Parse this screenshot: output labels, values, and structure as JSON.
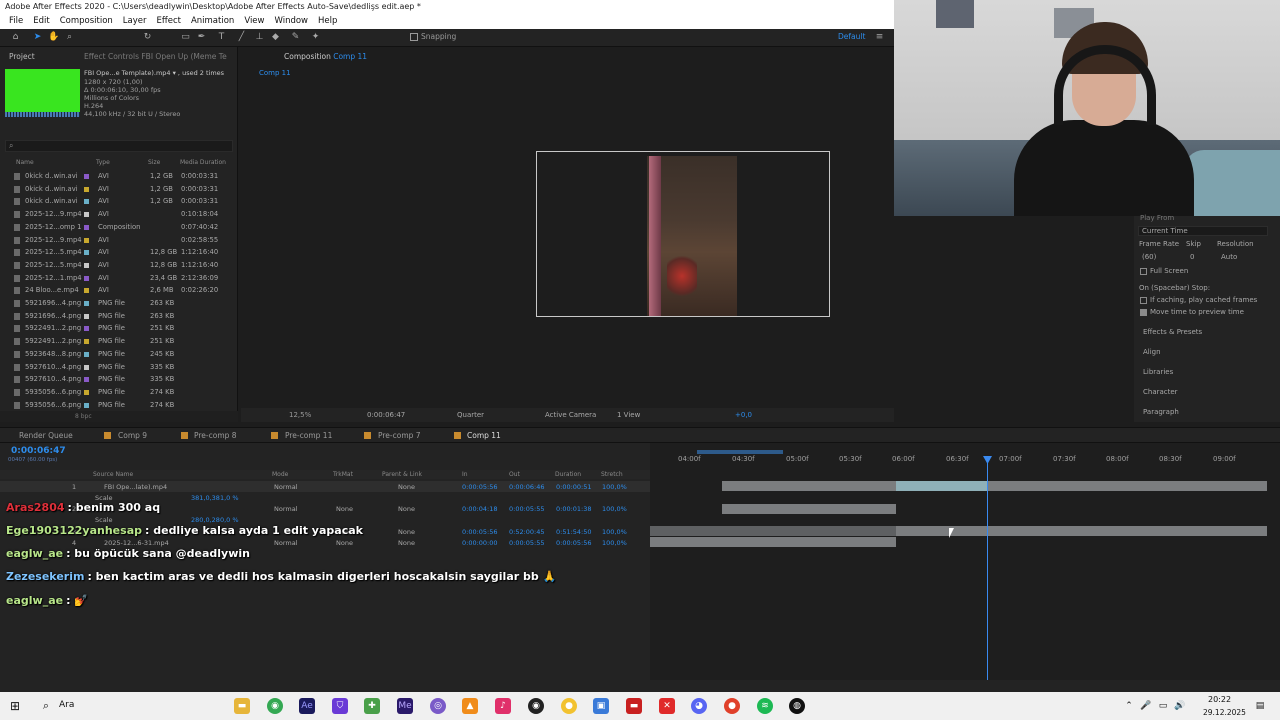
{
  "window": {
    "title": "Adobe After Effects 2020 - C:\\Users\\deadlywin\\Desktop\\Adobe After Effects Auto-Save\\dedlişs edit.aep *"
  },
  "menu": [
    "File",
    "Edit",
    "Composition",
    "Layer",
    "Effect",
    "Animation",
    "View",
    "Window",
    "Help"
  ],
  "toolbar": {
    "snapping": "Snapping",
    "workspace": "Default"
  },
  "project": {
    "tab": "Project",
    "effect_tab": "Effect Controls FBI Open Up (Meme Te",
    "file": {
      "name": "FBI Ope...e Template).mp4 ▾ , used 2 times",
      "size": "1280 x 720 (1,00)",
      "duration": "Δ 0:00:06:10, 30,00 fps",
      "colors": "Millions of Colors",
      "codec": "H.264",
      "audio": "44,100 kHz / 32 bit U / Stereo"
    },
    "search_glyph": "⌕",
    "columns": [
      "Name",
      "Type",
      "Size",
      "Media Duration"
    ],
    "items": [
      {
        "name": "0kick d..win.avi",
        "type": "AVI",
        "size": "1,2 GB",
        "dur": "0:00:03:31"
      },
      {
        "name": "0kick d..win.avi",
        "type": "AVI",
        "size": "1,2 GB",
        "dur": "0:00:03:31"
      },
      {
        "name": "0kick d..win.avi",
        "type": "AVI",
        "size": "1,2 GB",
        "dur": "0:00:03:31"
      },
      {
        "name": "2025-12...9.mp4",
        "type": "AVI",
        "size": "",
        "dur": "0:10:18:04"
      },
      {
        "name": "2025-12...omp 1",
        "type": "Composition",
        "size": "",
        "dur": "0:07:40:42"
      },
      {
        "name": "2025-12...9.mp4",
        "type": "AVI",
        "size": "",
        "dur": "0:02:58:55"
      },
      {
        "name": "2025-12...5.mp4",
        "type": "AVI",
        "size": "12,8 GB",
        "dur": "1:12:16:40"
      },
      {
        "name": "2025-12...5.mp4",
        "type": "AVI",
        "size": "12,8 GB",
        "dur": "1:12:16:40"
      },
      {
        "name": "2025-12...1.mp4",
        "type": "AVI",
        "size": "23,4 GB",
        "dur": "2:12:36:09"
      },
      {
        "name": "24 Bloo...e.mp4",
        "type": "AVI",
        "size": "2,6 MB",
        "dur": "0:02:26:20"
      },
      {
        "name": "5921696...4.png",
        "type": "PNG file",
        "size": "263 KB",
        "dur": ""
      },
      {
        "name": "5921696...4.png",
        "type": "PNG file",
        "size": "263 KB",
        "dur": ""
      },
      {
        "name": "5922491...2.png",
        "type": "PNG file",
        "size": "251 KB",
        "dur": ""
      },
      {
        "name": "5922491...2.png",
        "type": "PNG file",
        "size": "251 KB",
        "dur": ""
      },
      {
        "name": "5923648...8.png",
        "type": "PNG file",
        "size": "245 KB",
        "dur": ""
      },
      {
        "name": "5927610...4.png",
        "type": "PNG file",
        "size": "335 KB",
        "dur": ""
      },
      {
        "name": "5927610...4.png",
        "type": "PNG file",
        "size": "335 KB",
        "dur": ""
      },
      {
        "name": "5935056...6.png",
        "type": "PNG file",
        "size": "274 KB",
        "dur": ""
      },
      {
        "name": "5935056...6.png",
        "type": "PNG file",
        "size": "274 KB",
        "dur": ""
      }
    ],
    "footer_bpc": "8 bpc"
  },
  "composition": {
    "tab": "Composition",
    "comp_name": "Comp 11",
    "breadcrumb": "Comp 11",
    "zoom": "12,5%",
    "timecode": "0:00:06:47",
    "resolution": "Quarter",
    "camera": "Active Camera",
    "views": "1 View",
    "exposure": "+0,0"
  },
  "preview": {
    "play_from": "Play From",
    "play_from_value": "Current Time",
    "frame_rate_label": "Frame Rate",
    "skip_label": "Skip",
    "resolution_label": "Resolution",
    "frame_rate": "(60)",
    "skip": "0",
    "resolution": "Auto",
    "full_screen": "Full Screen",
    "spacebar": "On (Spacebar) Stop:",
    "if_caching": "If caching, play cached frames",
    "move_time": "Move time to preview time",
    "panels": [
      "Effects & Presets",
      "Align",
      "Libraries",
      "Character",
      "Paragraph"
    ]
  },
  "timeline": {
    "tabs": [
      "Render Queue",
      "Comp 9",
      "Pre-comp 8",
      "Pre-comp 11",
      "Pre-comp 7",
      "Comp 11"
    ],
    "timecode": "0:00:06:47",
    "timecode_sub": "00407 (60.00 fps)",
    "columns": [
      "Source Name",
      "Mode",
      "TrkMat",
      "Parent & Link",
      "In",
      "Out",
      "Duration",
      "Stretch"
    ],
    "layers": [
      {
        "num": "1",
        "name": "FBI Ope...late).mp4",
        "mode": "Normal",
        "trk": "",
        "parent": "None",
        "in": "0:00:05:56",
        "out": "0:00:06:46",
        "dur": "0:00:00:51",
        "stretch": "100,0%"
      },
      {
        "num": "",
        "name": "Scale",
        "mode": "",
        "trk": "",
        "parent": "",
        "in": "",
        "out": "",
        "dur": "",
        "stretch": "",
        "value": "381,0,381,0 %"
      },
      {
        "num": "2",
        "name": "",
        "mode": "Normal",
        "trk": "None",
        "parent": "None",
        "in": "0:00:04:18",
        "out": "0:00:05:55",
        "dur": "0:00:01:38",
        "stretch": "100,0%"
      },
      {
        "num": "",
        "name": "Scale",
        "mode": "",
        "trk": "",
        "parent": "",
        "in": "",
        "out": "",
        "dur": "",
        "stretch": "",
        "value": "280,0,280,0 %"
      },
      {
        "num": "3",
        "name": "",
        "mode": "",
        "trk": "None",
        "parent": "None",
        "in": "0:00:05:56",
        "out": "0:52:00:45",
        "dur": "0:51:54:50",
        "stretch": "100,0%"
      },
      {
        "num": "4",
        "name": "2025-12...6-31.mp4",
        "mode": "Normal",
        "trk": "None",
        "parent": "None",
        "in": "0:00:00:00",
        "out": "0:00:05:55",
        "dur": "0:00:05:56",
        "stretch": "100,0%"
      }
    ],
    "ruler": [
      "04:00f",
      "04:30f",
      "05:00f",
      "05:30f",
      "06:00f",
      "06:30f",
      "07:00f",
      "07:30f",
      "08:00f",
      "08:30f",
      "09:00f"
    ]
  },
  "chat": [
    {
      "user": "Aras2804",
      "user_color": "#e0303a",
      "text": ": benim 300 aq"
    },
    {
      "user": "Ege1903122yanhesap",
      "user_color": "#b8e68a",
      "text": ": dedliye kalsa ayda 1 edit yapacak"
    },
    {
      "user": "eaglw_ae",
      "user_color": "#b8e68a",
      "text": ": bu öpücük sana @deadlywin"
    },
    {
      "user": "Zezesekerim",
      "user_color": "#7fc4ff",
      "text": ": ben kactim aras ve dedli hos kalmasin digerleri hoscakalsin saygilar bb 🙏"
    },
    {
      "user": "eaglw_ae",
      "user_color": "#b8e68a",
      "text": ": 💅"
    }
  ],
  "taskbar": {
    "search": "Ara",
    "time": "20:22",
    "date": "29.12.2025"
  }
}
